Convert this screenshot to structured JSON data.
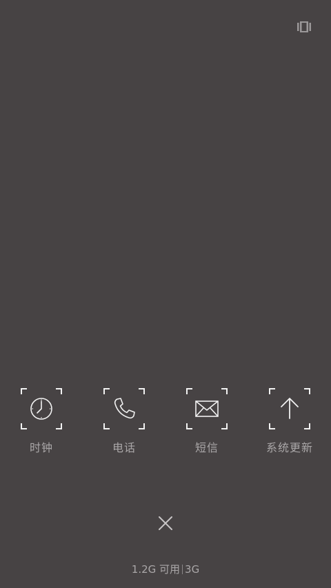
{
  "top_toggle": {
    "icon": "recent-apps-toggle-icon"
  },
  "apps": [
    {
      "label": "时钟",
      "icon": "clock-icon"
    },
    {
      "label": "电话",
      "icon": "phone-icon"
    },
    {
      "label": "短信",
      "icon": "message-icon"
    },
    {
      "label": "系统更新",
      "icon": "arrow-up-icon"
    }
  ],
  "close": {
    "icon": "close-icon"
  },
  "memory": {
    "available": "1.2G 可用",
    "total": "3G"
  },
  "colors": {
    "background": "#474344",
    "icon_stroke": "#f2f2f2",
    "label": "#aaa7a8"
  }
}
